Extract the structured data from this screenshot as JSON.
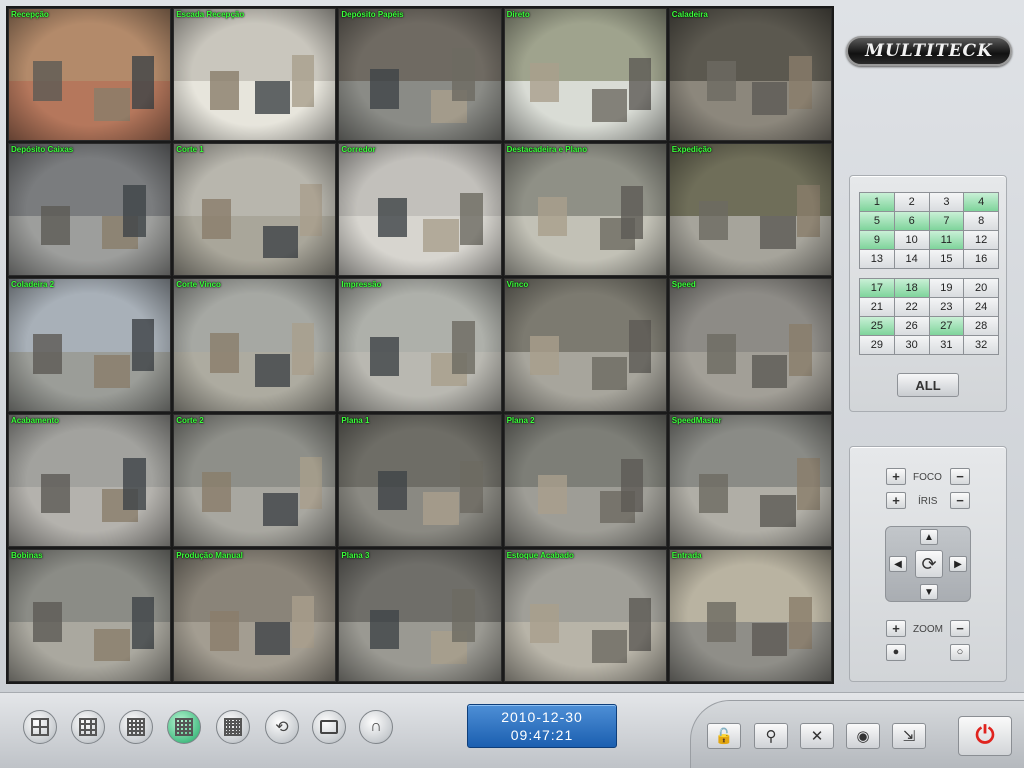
{
  "app": {
    "brand": "MULTITECK"
  },
  "cameras": [
    {
      "label": "Recepção",
      "bg": "#b38a6a",
      "floor": "#b5775c"
    },
    {
      "label": "Escada Recepção",
      "bg": "#c9c6bd",
      "floor": "#e7e5dc"
    },
    {
      "label": "Depósito Papéis",
      "bg": "#6f6a62",
      "floor": "#8a8b86"
    },
    {
      "label": "Direto",
      "bg": "#9fa38d",
      "floor": "#d9dcd5"
    },
    {
      "label": "Caladeira",
      "bg": "#5b584f",
      "floor": "#8c877c"
    },
    {
      "label": "Depósito Caixas",
      "bg": "#7a7c7e",
      "floor": "#9d9e9c"
    },
    {
      "label": "Corte 1",
      "bg": "#b8b6ad",
      "floor": "#a9a69a"
    },
    {
      "label": "Corredor",
      "bg": "#c2c0bb",
      "floor": "#d7d5cf"
    },
    {
      "label": "Destacadeira e Plano",
      "bg": "#8f9086",
      "floor": "#c2c1b6"
    },
    {
      "label": "Expedição",
      "bg": "#6f6e59",
      "floor": "#a6a49b"
    },
    {
      "label": "Coladeira 2",
      "bg": "#a8b0b8",
      "floor": "#9b9d98"
    },
    {
      "label": "Corte Vinco",
      "bg": "#a6a8a3",
      "floor": "#adaba0"
    },
    {
      "label": "Impressão",
      "bg": "#aeb0aa",
      "floor": "#b9b8b1"
    },
    {
      "label": "Vinco",
      "bg": "#7c7a70",
      "floor": "#a7a59c"
    },
    {
      "label": "Speed",
      "bg": "#8d8b86",
      "floor": "#a29f97"
    },
    {
      "label": "Acabamento",
      "bg": "#a2a29e",
      "floor": "#b4b2ad"
    },
    {
      "label": "Corte 2",
      "bg": "#8e8f89",
      "floor": "#a8a7a0"
    },
    {
      "label": "Plana 1",
      "bg": "#6e6d66",
      "floor": "#8a8982"
    },
    {
      "label": "Plana 2",
      "bg": "#7d7e77",
      "floor": "#9e9d96"
    },
    {
      "label": "SpeedMaster",
      "bg": "#8a8b86",
      "floor": "#b0aea6"
    },
    {
      "label": "Bobinas",
      "bg": "#8b8c86",
      "floor": "#aaa89f"
    },
    {
      "label": "Produção Manual",
      "bg": "#8a8479",
      "floor": "#a39d91"
    },
    {
      "label": "Plana 3",
      "bg": "#6f6e69",
      "floor": "#9a9992"
    },
    {
      "label": "Estoque Acabado",
      "bg": "#a09f98",
      "floor": "#b8b4a8"
    },
    {
      "label": "Entrada",
      "bg": "#b9b3a1",
      "floor": "#8f8e88"
    }
  ],
  "channels": {
    "group1": [
      {
        "n": "1",
        "on": true
      },
      {
        "n": "2",
        "on": false
      },
      {
        "n": "3",
        "on": false
      },
      {
        "n": "4",
        "on": true
      },
      {
        "n": "5",
        "on": true
      },
      {
        "n": "6",
        "on": true
      },
      {
        "n": "7",
        "on": true
      },
      {
        "n": "8",
        "on": false
      },
      {
        "n": "9",
        "on": true
      },
      {
        "n": "10",
        "on": false
      },
      {
        "n": "11",
        "on": true
      },
      {
        "n": "12",
        "on": false
      },
      {
        "n": "13",
        "on": false
      },
      {
        "n": "14",
        "on": false
      },
      {
        "n": "15",
        "on": false
      },
      {
        "n": "16",
        "on": false
      }
    ],
    "group2": [
      {
        "n": "17",
        "on": true
      },
      {
        "n": "18",
        "on": true
      },
      {
        "n": "19",
        "on": false
      },
      {
        "n": "20",
        "on": false
      },
      {
        "n": "21",
        "on": false
      },
      {
        "n": "22",
        "on": false
      },
      {
        "n": "23",
        "on": false
      },
      {
        "n": "24",
        "on": false
      },
      {
        "n": "25",
        "on": true
      },
      {
        "n": "26",
        "on": false
      },
      {
        "n": "27",
        "on": true
      },
      {
        "n": "28",
        "on": false
      },
      {
        "n": "29",
        "on": false
      },
      {
        "n": "30",
        "on": false
      },
      {
        "n": "31",
        "on": false
      },
      {
        "n": "32",
        "on": false
      }
    ],
    "all_label": "ALL"
  },
  "ptz": {
    "focus_label": "FOCO",
    "iris_label": "ÍRIS",
    "zoom_label": "ZOOM",
    "plus": "+",
    "minus": "−",
    "up": "▲",
    "down": "▼",
    "left": "◀",
    "right": "▶",
    "center": "⟳"
  },
  "clock": {
    "date": "2010-12-30",
    "time": "09:47:21"
  },
  "layouts": [
    {
      "name": "layout-1x1",
      "n": 2,
      "active": false
    },
    {
      "name": "layout-2x2",
      "n": 3,
      "active": false
    },
    {
      "name": "layout-3x3",
      "n": 4,
      "active": false
    },
    {
      "name": "layout-4x4",
      "n": 4,
      "active": true
    },
    {
      "name": "layout-5x5",
      "n": 5,
      "active": false
    }
  ],
  "toolbar": {
    "lock": "🔓",
    "search": "⚲",
    "settings": "✕",
    "record": "◉",
    "minimize": "⇲",
    "power": "⏻"
  },
  "colors": {
    "active_channel": "#7fd49b",
    "clock_bg": "#1b5fb0",
    "power": "#e0231e",
    "camera_label": "#3aff3a"
  }
}
